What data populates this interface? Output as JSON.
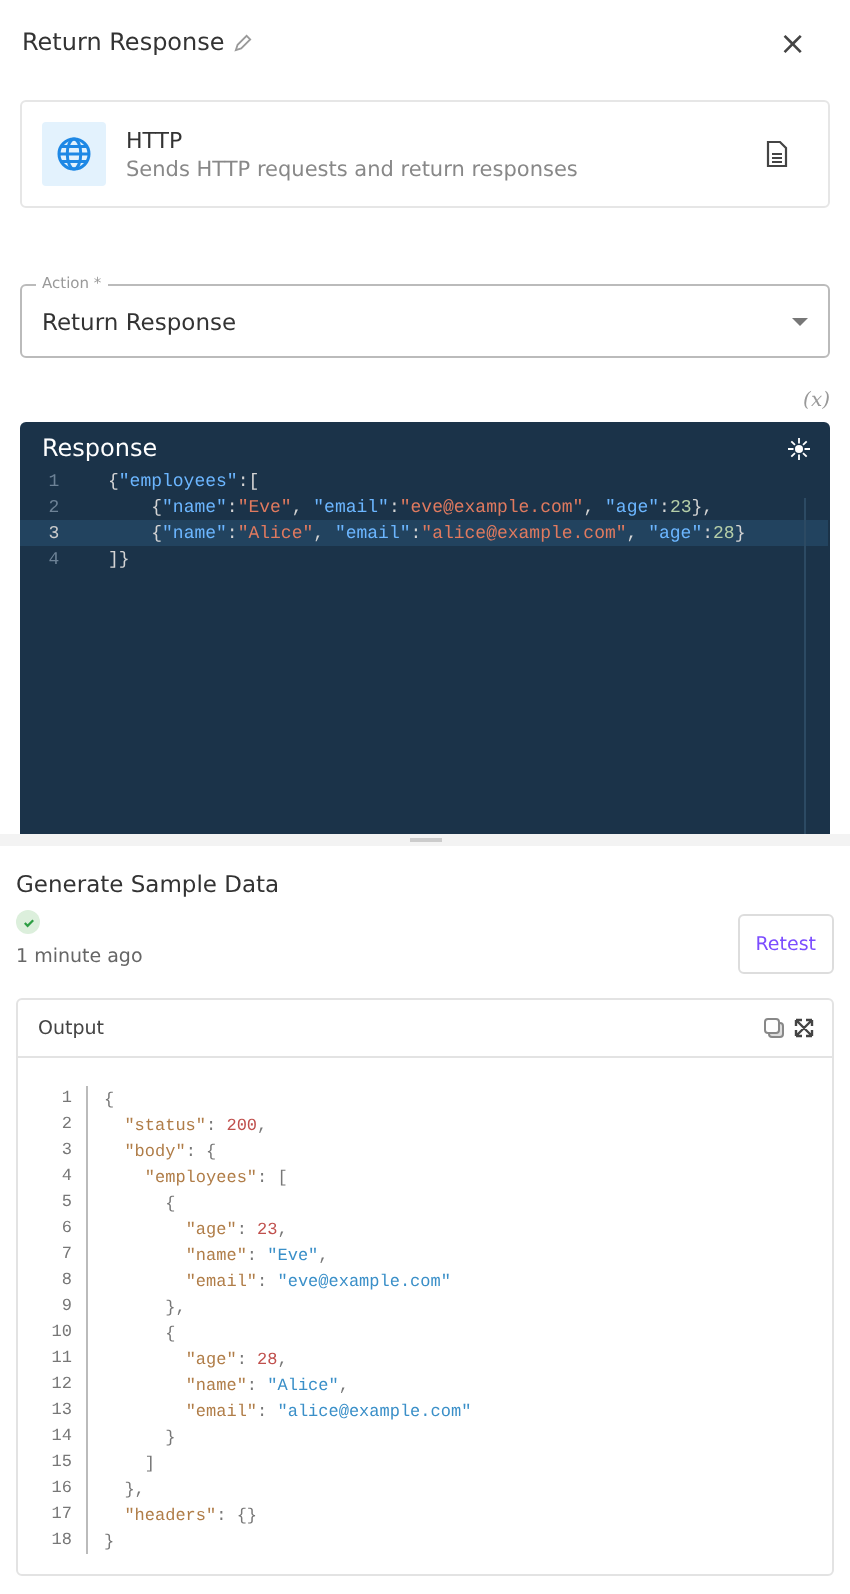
{
  "header": {
    "title": "Return Response",
    "close": "×"
  },
  "app_card": {
    "name": "HTTP",
    "description": "Sends HTTP requests and return responses"
  },
  "action_field": {
    "label": "Action *",
    "value": "Return Response"
  },
  "variable_toggle": "(x)",
  "response_editor": {
    "title": "Response",
    "lines": [
      {
        "number": "1",
        "text": "{\"employees\":[",
        "active": false
      },
      {
        "number": "2",
        "text": "    {\"name\":\"Eve\", \"email\":\"eve@example.com\", \"age\":23},",
        "active": false
      },
      {
        "number": "3",
        "text": "    {\"name\":\"Alice\", \"email\":\"alice@example.com\", \"age\":28}",
        "active": true
      },
      {
        "number": "4",
        "text": "]}",
        "active": false
      }
    ]
  },
  "sample_data": {
    "title": "Generate Sample Data",
    "passed": true,
    "time": "1 minute ago",
    "retest_button": "Retest"
  },
  "output": {
    "title": "Output",
    "lines": [
      {
        "number": "1",
        "text": "{"
      },
      {
        "number": "2",
        "text": "  \"status\": 200,"
      },
      {
        "number": "3",
        "text": "  \"body\": {"
      },
      {
        "number": "4",
        "text": "    \"employees\": ["
      },
      {
        "number": "5",
        "text": "      {"
      },
      {
        "number": "6",
        "text": "        \"age\": 23,"
      },
      {
        "number": "7",
        "text": "        \"name\": \"Eve\","
      },
      {
        "number": "8",
        "text": "        \"email\": \"eve@example.com\""
      },
      {
        "number": "9",
        "text": "      },"
      },
      {
        "number": "10",
        "text": "      {"
      },
      {
        "number": "11",
        "text": "        \"age\": 28,"
      },
      {
        "number": "12",
        "text": "        \"name\": \"Alice\","
      },
      {
        "number": "13",
        "text": "        \"email\": \"alice@example.com\""
      },
      {
        "number": "14",
        "text": "      }"
      },
      {
        "number": "15",
        "text": "    ]"
      },
      {
        "number": "16",
        "text": "  },"
      },
      {
        "number": "17",
        "text": "  \"headers\": {}"
      },
      {
        "number": "18",
        "text": "}"
      }
    ]
  }
}
